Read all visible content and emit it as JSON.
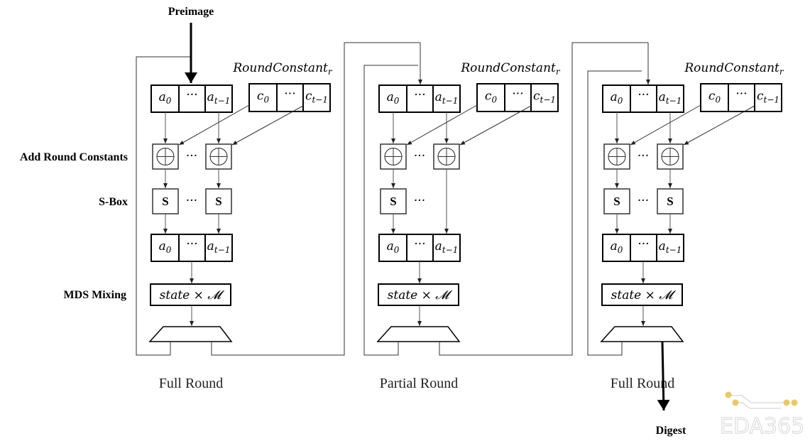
{
  "input_label": "Preimage",
  "output_label": "Digest",
  "row_labels": {
    "add_round_constants": "Add Round Constants",
    "sbox": "S-Box",
    "mds_mixing": "MDS Mixing"
  },
  "state_cells": [
    {
      "base": "a",
      "sub": "0"
    },
    {
      "base": "···",
      "sub": ""
    },
    {
      "base": "a",
      "sub": "t−1"
    }
  ],
  "constant_cells": [
    {
      "base": "c",
      "sub": "0"
    },
    {
      "base": "···",
      "sub": ""
    },
    {
      "base": "c",
      "sub": "t−1"
    }
  ],
  "constant_label": {
    "base": "RoundConstant",
    "sub": "r"
  },
  "sbox_label": "S",
  "ellipsis": "···",
  "mds_label": "state × 𝓜",
  "rounds": [
    {
      "caption": "Full Round",
      "type": "full"
    },
    {
      "caption": "Partial Round",
      "type": "partial"
    },
    {
      "caption": "Full Round",
      "type": "full"
    }
  ],
  "watermark": "EDA365",
  "watermark_accent": "#e8c96a"
}
